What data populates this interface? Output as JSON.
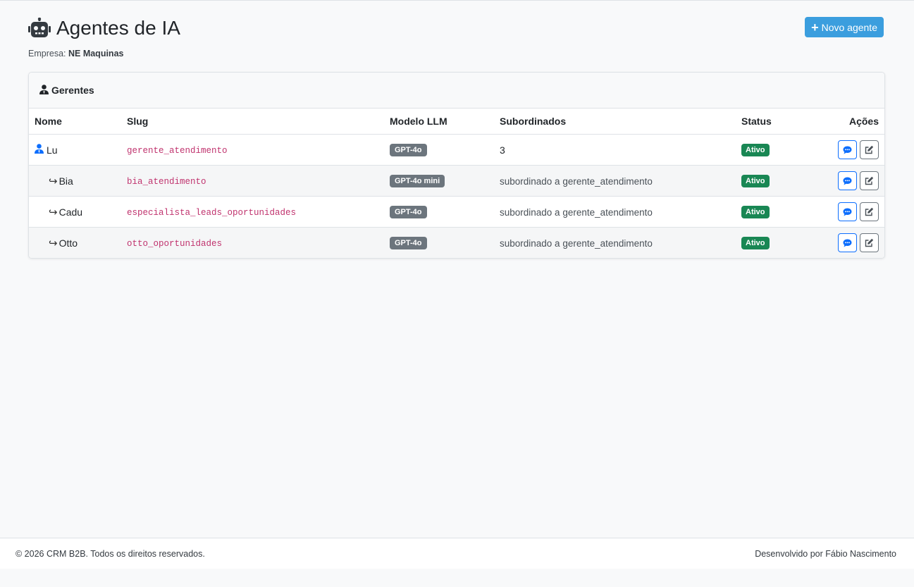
{
  "header": {
    "title": "Agentes de IA",
    "new_button_label": "Novo agente",
    "company_label": "Empresa:",
    "company_name": "NE Maquinas"
  },
  "card": {
    "title": "Gerentes",
    "columns": {
      "name": "Nome",
      "slug": "Slug",
      "model": "Modelo LLM",
      "subordinates": "Subordinados",
      "status": "Status",
      "actions": "Ações"
    },
    "rows": [
      {
        "name": "Lu",
        "slug": "gerente_atendimento",
        "model": "GPT-4o",
        "subordinates": "3",
        "status": "Ativo",
        "is_manager": true
      },
      {
        "name": "Bia",
        "slug": "bia_atendimento",
        "model": "GPT-4o mini",
        "subordinates": "subordinado a gerente_atendimento",
        "status": "Ativo",
        "is_manager": false
      },
      {
        "name": "Cadu",
        "slug": "especialista_leads_oportunidades",
        "model": "GPT-4o",
        "subordinates": "subordinado a gerente_atendimento",
        "status": "Ativo",
        "is_manager": false
      },
      {
        "name": "Otto",
        "slug": "otto_oportunidades",
        "model": "GPT-4o",
        "subordinates": "subordinado a gerente_atendimento",
        "status": "Ativo",
        "is_manager": false
      }
    ]
  },
  "footer": {
    "copyright": "© 2026 CRM B2B. Todos os direitos reservados.",
    "developer": "Desenvolvido por Fábio Nascimento"
  },
  "icons": {
    "title": "robot-icon",
    "new_button": "plus-icon",
    "card_header": "user-tie-icon",
    "manager": "user-tie-icon",
    "child": "arrow-return-right-icon",
    "chat": "chat-icon",
    "edit": "edit-icon"
  },
  "colors": {
    "primary_button": "#3b9ede",
    "slug_text": "#c0336e",
    "model_badge": "#6c757d",
    "status_badge": "#198754",
    "chat_outline": "#0d6efd"
  }
}
